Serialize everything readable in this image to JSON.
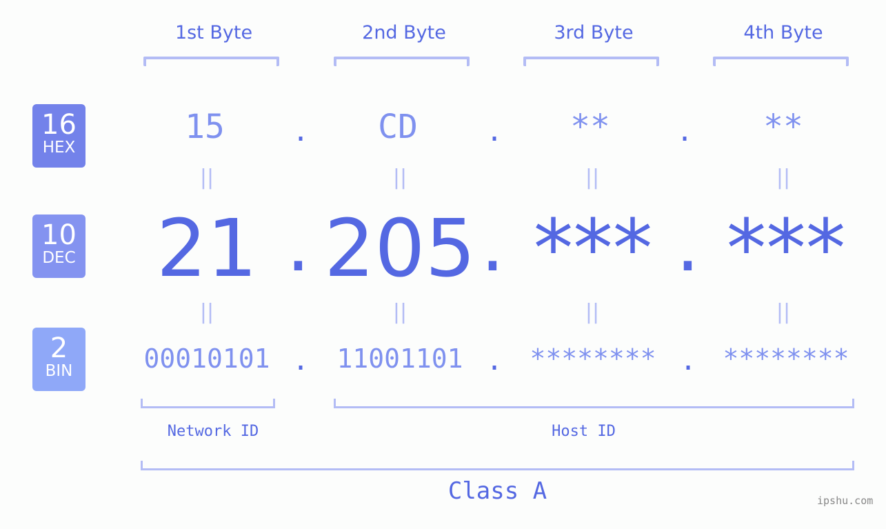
{
  "bytes": [
    {
      "header": "1st Byte",
      "hex": "15",
      "dec": "21",
      "bin": "00010101"
    },
    {
      "header": "2nd Byte",
      "hex": "CD",
      "dec": "205",
      "bin": "11001101"
    },
    {
      "header": "3rd Byte",
      "hex": "**",
      "dec": "***",
      "bin": "********"
    },
    {
      "header": "4th Byte",
      "hex": "**",
      "dec": "***",
      "bin": "********"
    }
  ],
  "badges": [
    {
      "number": "16",
      "label": "HEX",
      "color": "#7382ea"
    },
    {
      "number": "10",
      "label": "DEC",
      "color": "#8493f0"
    },
    {
      "number": "2",
      "label": "BIN",
      "color": "#8fa8f8"
    }
  ],
  "separator": ".",
  "equals": "||",
  "network_label": "Network ID",
  "host_label": "Host ID",
  "class_label": "Class A",
  "watermark": "ipshu.com",
  "colors": {
    "primary": "#5468e2",
    "secondary": "#7f91ef",
    "bracket": "#b3bcf5"
  }
}
